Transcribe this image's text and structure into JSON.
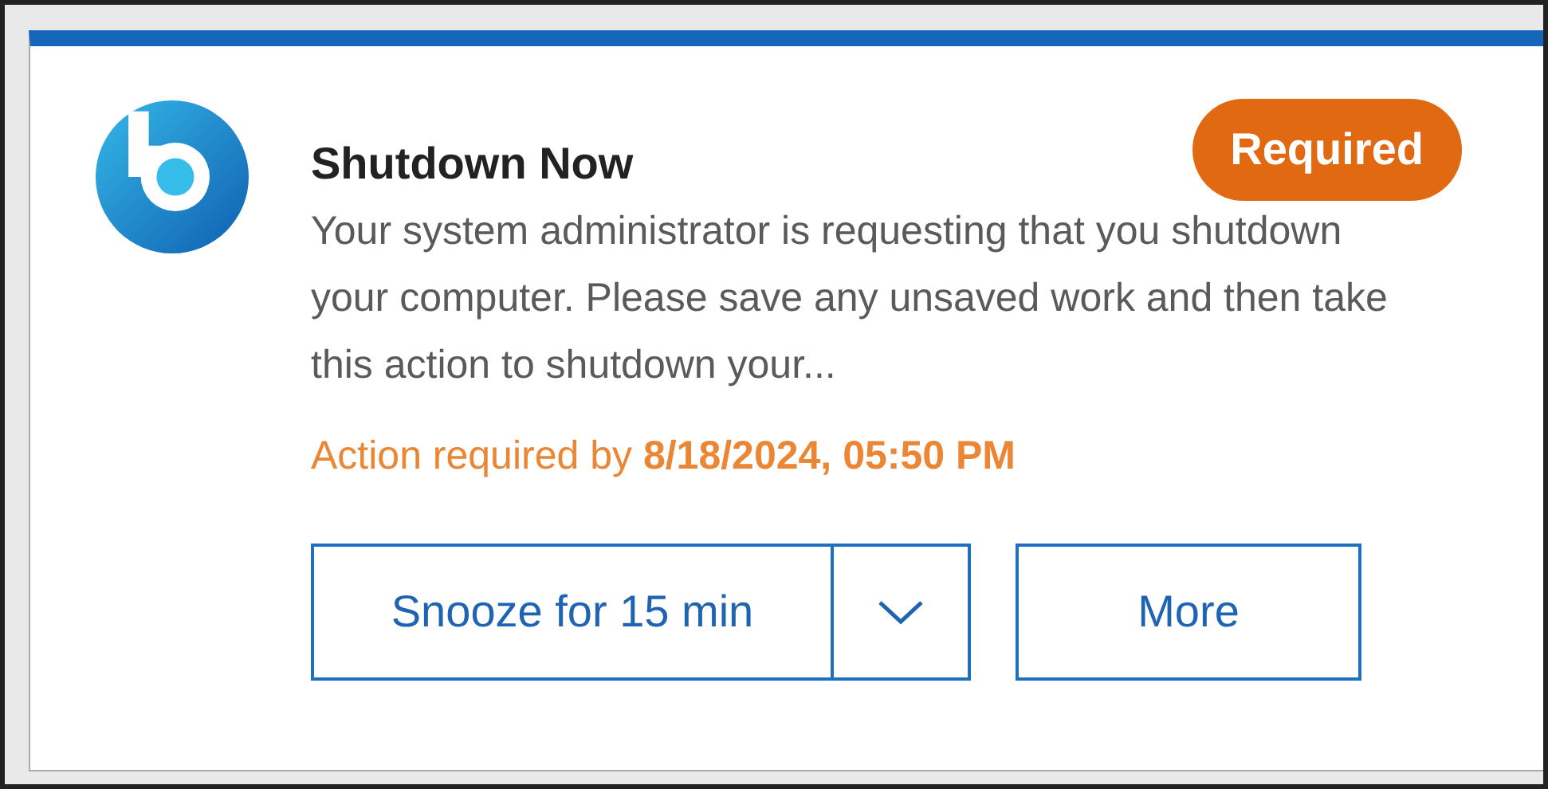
{
  "notification": {
    "title": "Shutdown Now",
    "badge": "Required",
    "message": "Your system administrator is requesting that you shutdown your computer. Please save any unsaved work and then take this action to shutdown your...",
    "deadline": "Action required by **8/18/2024, 05:50 PM**",
    "buttons": [
      {
        "kind": "split",
        "label": "Snooze for 15 min"
      },
      {
        "kind": "plain",
        "label": "More"
      }
    ]
  }
}
